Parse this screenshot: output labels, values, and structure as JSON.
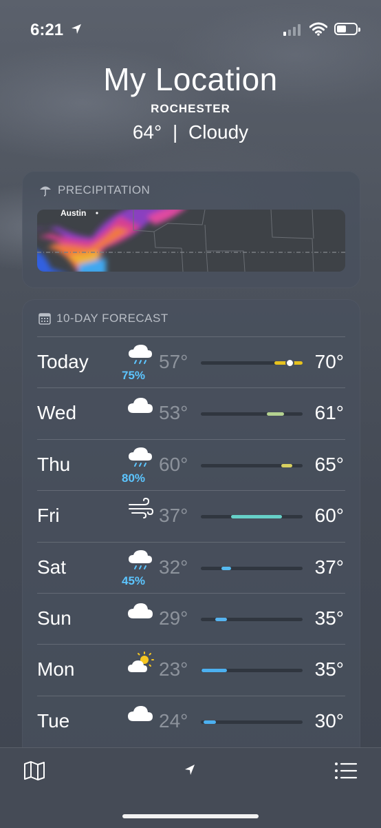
{
  "status": {
    "time": "6:21",
    "icons": [
      "location-arrow-icon",
      "cellular-signal-icon",
      "wifi-icon",
      "battery-icon"
    ]
  },
  "header": {
    "title": "My Location",
    "city": "ROCHESTER",
    "temperature": "64°",
    "separator": "|",
    "condition": "Cloudy"
  },
  "precipitation": {
    "label": "PRECIPITATION",
    "icon": "umbrella-icon",
    "map_label": "Austin"
  },
  "forecast": {
    "label": "10-DAY FORECAST",
    "icon": "calendar-icon",
    "days": [
      {
        "day": "Today",
        "icon": "cloud-rain-icon",
        "chance": "75%",
        "low": "57°",
        "high": "70°",
        "range": [
          0.72,
          1.0
        ],
        "color": "#e6c21e",
        "current": true
      },
      {
        "day": "Wed",
        "icon": "cloud-icon",
        "chance": "",
        "low": "53°",
        "high": "61°",
        "range": [
          0.65,
          0.82
        ],
        "color": "#b4d290",
        "current": false
      },
      {
        "day": "Thu",
        "icon": "cloud-rain-icon",
        "chance": "80%",
        "low": "60°",
        "high": "65°",
        "range": [
          0.79,
          0.9
        ],
        "color": "#d8d060",
        "current": false
      },
      {
        "day": "Fri",
        "icon": "wind-icon",
        "chance": "",
        "low": "37°",
        "high": "60°",
        "range": [
          0.3,
          0.8
        ],
        "color": "#66d0c8",
        "current": false
      },
      {
        "day": "Sat",
        "icon": "cloud-rain-icon",
        "chance": "45%",
        "low": "32°",
        "high": "37°",
        "range": [
          0.2,
          0.3
        ],
        "color": "#56baf0",
        "current": false
      },
      {
        "day": "Sun",
        "icon": "cloud-icon",
        "chance": "",
        "low": "29°",
        "high": "35°",
        "range": [
          0.14,
          0.26
        ],
        "color": "#56b4f0",
        "current": false
      },
      {
        "day": "Mon",
        "icon": "partly-sunny-icon",
        "chance": "",
        "low": "23°",
        "high": "35°",
        "range": [
          0.01,
          0.26
        ],
        "color": "#4cb0f0",
        "current": false
      },
      {
        "day": "Tue",
        "icon": "cloud-icon",
        "chance": "",
        "low": "24°",
        "high": "30°",
        "range": [
          0.03,
          0.15
        ],
        "color": "#4cb0f0",
        "current": false
      }
    ]
  },
  "tabbar": {
    "items": [
      "map-icon",
      "location-arrow-icon",
      "list-icon"
    ]
  }
}
